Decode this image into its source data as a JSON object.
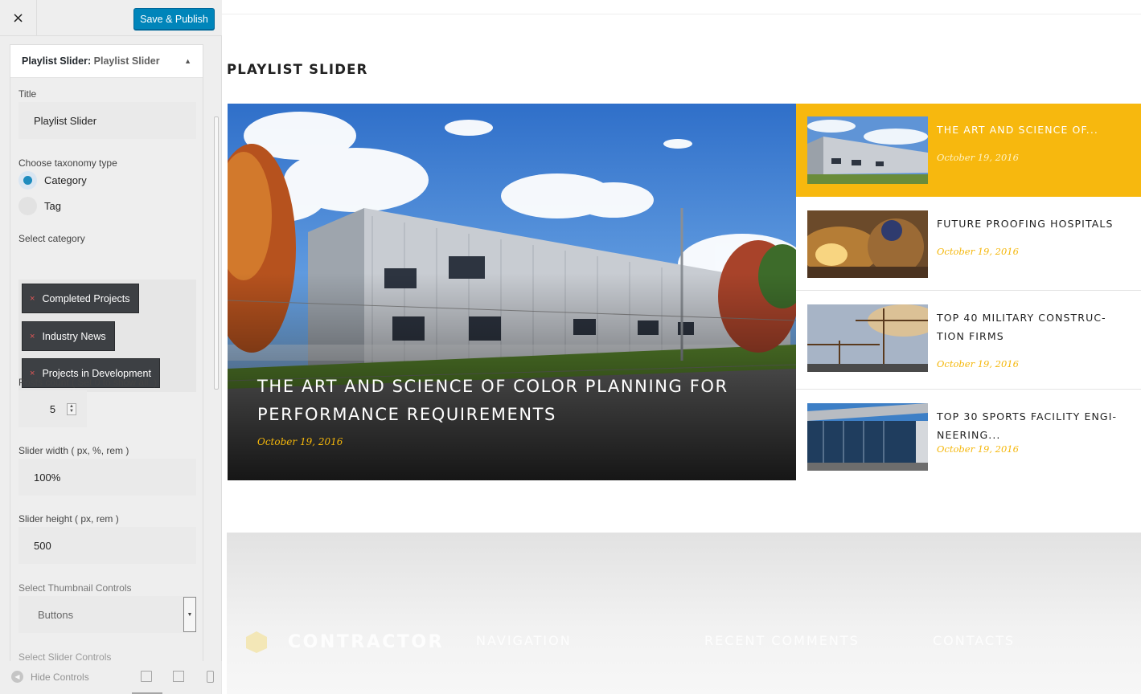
{
  "customizer": {
    "close_icon": "×",
    "publish_label": "Save & Publish",
    "widget": {
      "title_strong": "Playlist Slider:",
      "title_rest": "Playlist Slider",
      "collapse_icon": "▲"
    },
    "fields": {
      "title_label": "Title",
      "title_value": "Playlist Slider",
      "taxonomy_label": "Choose taxonomy type",
      "taxonomy_options": [
        "Category",
        "Tag"
      ],
      "taxonomy_selected": "Category",
      "category_label": "Select category",
      "categories": [
        "Completed Projects",
        "Industry News",
        "Projects in Development"
      ],
      "chip_remove_icon": "×",
      "posts_count_label": "Posts count ( Set 0 to show all. )",
      "posts_count_value": "5",
      "slider_width_label": "Slider width ( px, %, rem )",
      "slider_width_value": "100%",
      "slider_height_label": "Slider height ( px, rem )",
      "slider_height_value": "500",
      "thumb_controls_label": "Select Thumbnail Controls",
      "thumb_controls_value": "Buttons",
      "slider_controls_label": "Select Slider Controls"
    },
    "footer": {
      "hide_controls_label": "Hide Controls"
    }
  },
  "preview": {
    "section_title": "PLAYLIST SLIDER",
    "main_slide": {
      "title": "THE ART AND SCIENCE OF COLOR PLANNING FOR PERFORMANCE REQUIREMENTS",
      "date": "October 19, 2016"
    },
    "playlist": [
      {
        "title": "THE ART AND SCIENCE OF...",
        "date": "October 19, 2016",
        "active": true
      },
      {
        "title": "FUTURE PROOFING HOSPITALS",
        "date": "October 19, 2016",
        "active": false
      },
      {
        "title": "TOP 40 MILITARY CONSTRUC-TION FIRMS",
        "date": "October 19, 2016",
        "active": false
      },
      {
        "title": "TOP 30 SPORTS FACILITY ENGI-NEERING...",
        "date": "October 19, 2016",
        "active": false
      }
    ],
    "footer": {
      "brand": "CONTRACTOR",
      "headings": [
        "NAVIGATION",
        "RECENT COMMENTS",
        "CONTACTS"
      ]
    }
  },
  "colors": {
    "accent": "#f7b80e",
    "publish": "#0085ba",
    "chip": "#3d4044"
  }
}
